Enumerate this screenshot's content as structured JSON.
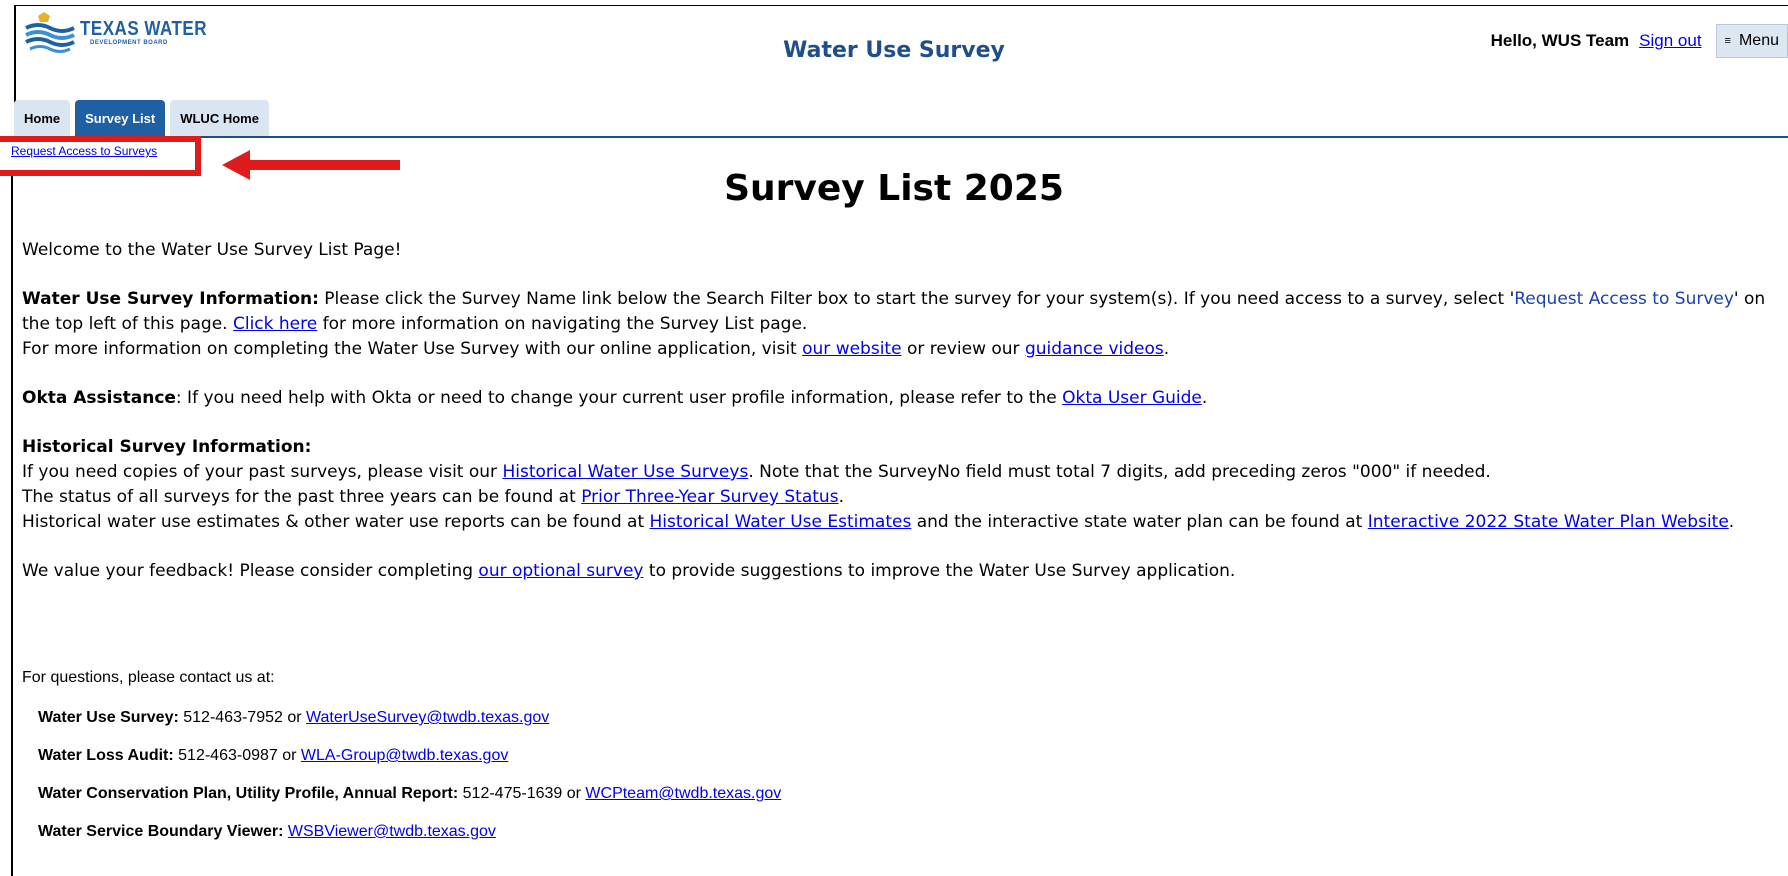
{
  "header": {
    "logo": {
      "line1": "TEXAS WATER",
      "line2": "DEVELOPMENT BOARD"
    },
    "app_title": "Water Use Survey",
    "greeting": "Hello, WUS Team",
    "sign_out": "Sign out",
    "menu_label": "Menu",
    "menu_icon": "hamburger-icon"
  },
  "tabs": [
    {
      "label": "Home",
      "active": false
    },
    {
      "label": "Survey List",
      "active": true
    },
    {
      "label": "WLUC Home",
      "active": false
    }
  ],
  "request_access_link": "Request Access to Surveys",
  "annotation": {
    "highlight_color": "#e01b1b",
    "arrow_color": "#e01b1b"
  },
  "page_title": "Survey List 2025",
  "intro": {
    "welcome": "Welcome to the Water Use Survey List Page!",
    "wus_info_label": "Water Use Survey Information:",
    "wus_info_text1": " Please click the Survey Name link below the Search Filter box to start the survey for your system(s). If you need access to a survey, select '",
    "wus_info_highlight": "Request Access to Survey",
    "wus_info_text2": "' on the top left of this page. ",
    "click_here": "Click here",
    "wus_info_text3": " for more information on navigating the Survey List page.",
    "more_info_text1": "For more information on completing the Water Use Survey with our online application, visit ",
    "our_website": "our website",
    "more_info_text2": " or review our ",
    "guidance_videos": "guidance videos",
    "more_info_text3": ".",
    "okta_label": "Okta Assistance",
    "okta_text1": ": If you need help with Okta or need to change your current user profile information, please refer to the ",
    "okta_link": "Okta User Guide",
    "okta_text2": ".",
    "hist_label": "Historical Survey Information:",
    "hist_text1": "If you need copies of your past surveys, please visit our ",
    "hist_link1": "Historical Water Use Surveys",
    "hist_text2": ". Note that the SurveyNo field must total 7 digits, add preceding zeros \"000\" if needed.",
    "status_text1": "The status of all surveys for the past three years can be found at ",
    "status_link": "Prior Three-Year Survey Status",
    "status_text2": ".",
    "est_text1": "Historical water use estimates & other water use reports can be found at ",
    "est_link": "Historical Water Use Estimates",
    "est_text2": " and the interactive state water plan can be found at ",
    "plan_link": "Interactive 2022 State Water Plan Website",
    "est_text3": ".",
    "feedback_text1": "We value your feedback! Please consider completing ",
    "feedback_link": "our optional survey",
    "feedback_text2": " to provide suggestions to improve the Water Use Survey application."
  },
  "contacts": {
    "intro": "For questions, please contact us at:",
    "rows": [
      {
        "label": "Water Use Survey:",
        "text": " 512-463-7952 or ",
        "email": "WaterUseSurvey@twdb.texas.gov"
      },
      {
        "label": "Water Loss Audit:",
        "text": " 512-463-0987 or ",
        "email": "WLA-Group@twdb.texas.gov"
      },
      {
        "label": "Water Conservation Plan, Utility Profile, Annual Report:",
        "text": " 512-475-1639 or ",
        "email": "WCPteam@twdb.texas.gov"
      },
      {
        "label": "Water Service Boundary Viewer:",
        "text": " ",
        "email": "WSBViewer@twdb.texas.gov"
      }
    ]
  }
}
